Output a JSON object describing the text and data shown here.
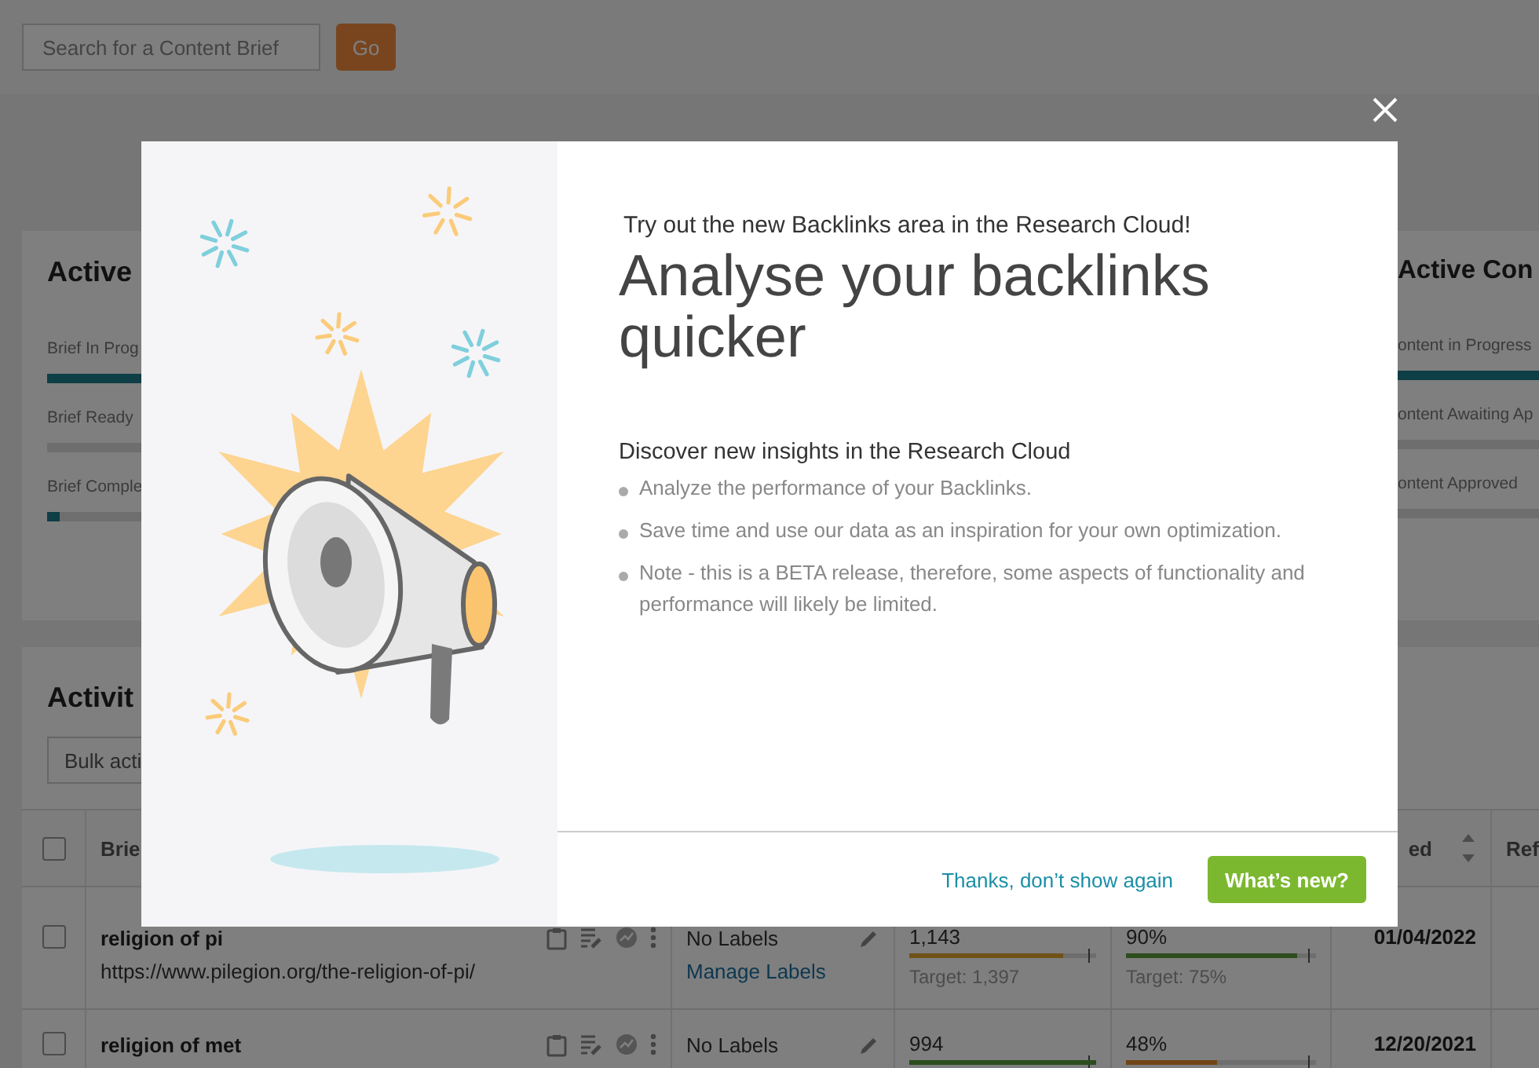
{
  "top_bar": {
    "search": {
      "placeholder": "Search for a Content Brief"
    },
    "go_button": "Go"
  },
  "brief_card": {
    "title": "Active",
    "bars": [
      {
        "label": "Brief In Prog",
        "level": 0.5
      },
      {
        "label": "Brief Ready",
        "level": 0
      },
      {
        "label": "Brief Comple",
        "level": 0.01
      }
    ]
  },
  "content_card": {
    "title": "Active Con",
    "bars": [
      {
        "label": "ontent in Progress",
        "level": 1
      },
      {
        "label": "ontent Awaiting Ap",
        "level": 0
      },
      {
        "label": "ontent Approved",
        "level": 0
      }
    ]
  },
  "activity_card": {
    "title": "Activit",
    "bulk_select": {
      "value": "Bulk acti"
    }
  },
  "table": {
    "header_checked": false,
    "columns": [
      "Brie",
      "ed",
      "Ref"
    ],
    "rows": [
      {
        "checked": false,
        "title": "religion of pi",
        "url": "https://www.pilegion.org/the-religion-of-pi/",
        "labels": "No Labels",
        "manage_link": "Manage Labels",
        "words": "1,143",
        "words_meter": {
          "level": 0.82,
          "color": "#705217"
        },
        "words_target": "Target: 1,397",
        "score": "90%",
        "score_meter": {
          "level": 0.9,
          "color": "#2d4d1d"
        },
        "score_target": "Target: 75%",
        "date": "01/04/2022"
      },
      {
        "checked": false,
        "title": "religion of met",
        "labels": "No Labels",
        "words": "994",
        "words_meter": {
          "level": 1,
          "color": "#2d4d1d"
        },
        "score": "48%",
        "score_meter": {
          "level": 0.48,
          "color": "#704517"
        },
        "date": "12/20/2021"
      }
    ]
  },
  "modal": {
    "kicker": "Try out the new Backlinks area in the Research Cloud!",
    "title": "Analyse your backlinks quicker",
    "section_heading": "Discover new insights in the Research Cloud",
    "bullets": [
      "Analyze the performance of your Backlinks.",
      "Save time and use our data as an inspiration for your own optimization.",
      "Note - this is a BETA release, therefore, some aspects of functionality and performance will likely be limited."
    ],
    "dismiss_link": "Thanks, don’t show again",
    "primary_button": "What’s new?"
  }
}
